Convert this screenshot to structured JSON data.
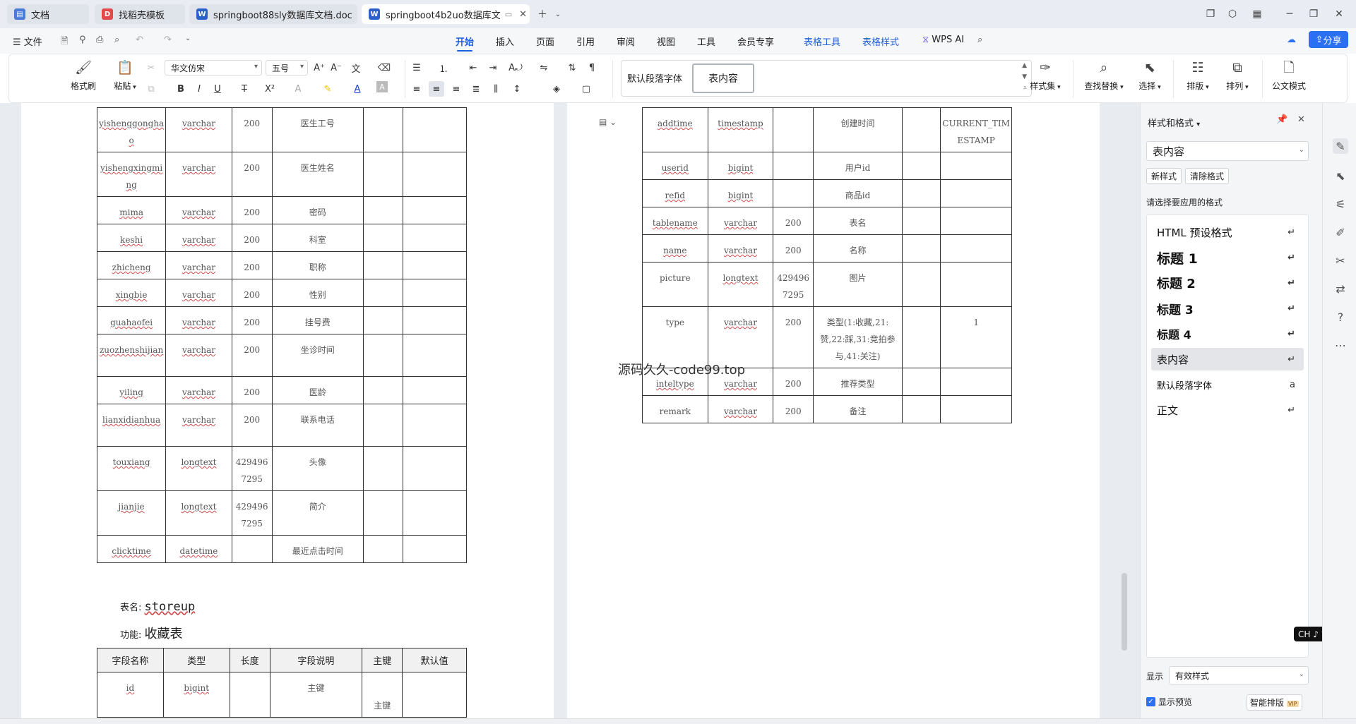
{
  "tabs": [
    {
      "label": "文档",
      "icon": "docs-icon",
      "color": "#4a7bd8"
    },
    {
      "label": "找稻壳模板",
      "icon": "docer-icon",
      "color": "#e24a4a"
    },
    {
      "label": "springboot88sly数据库文档.doc",
      "icon": "word-icon",
      "color": "#2b5fc9"
    },
    {
      "label": "springboot4b2uo数据库文",
      "icon": "word-icon",
      "color": "#2b5fc9"
    }
  ],
  "menu": {
    "file": "文件",
    "items": [
      "开始",
      "插入",
      "页面",
      "引用",
      "审阅",
      "视图",
      "工具",
      "会员专享",
      "表格工具",
      "表格样式"
    ],
    "wps_ai": "WPS AI",
    "share": "分享"
  },
  "ribbon": {
    "format_painter": "格式刷",
    "paste": "粘贴",
    "font_name": "华文仿宋",
    "font_size": "五号",
    "style_default": "默认段落字体",
    "style_current": "表内容",
    "style_set": "样式集",
    "find_replace": "查找替换",
    "select": "选择",
    "layout": "排版",
    "arrange": "排列",
    "official": "公文模式"
  },
  "left_table_rows": [
    {
      "name": "yishenggonghao",
      "type": "varchar",
      "len": "200",
      "desc": "医生工号",
      "pk": "",
      "def": ""
    },
    {
      "name": "yishengxingming",
      "type": "varchar",
      "len": "200",
      "desc": "医生姓名",
      "pk": "",
      "def": ""
    },
    {
      "name": "mima",
      "type": "varchar",
      "len": "200",
      "desc": "密码",
      "pk": "",
      "def": ""
    },
    {
      "name": "keshi",
      "type": "varchar",
      "len": "200",
      "desc": "科室",
      "pk": "",
      "def": ""
    },
    {
      "name": "zhicheng",
      "type": "varchar",
      "len": "200",
      "desc": "职称",
      "pk": "",
      "def": ""
    },
    {
      "name": "xingbie",
      "type": "varchar",
      "len": "200",
      "desc": "性别",
      "pk": "",
      "def": ""
    },
    {
      "name": "guahaofei",
      "type": "varchar",
      "len": "200",
      "desc": "挂号费",
      "pk": "",
      "def": ""
    },
    {
      "name": "zuozhenshijian",
      "type": "varchar",
      "len": "200",
      "desc": "坐诊时间",
      "pk": "",
      "def": ""
    },
    {
      "name": "yiling",
      "type": "varchar",
      "len": "200",
      "desc": "医龄",
      "pk": "",
      "def": ""
    },
    {
      "name": "lianxidianhua",
      "type": "varchar",
      "len": "200",
      "desc": "联系电话",
      "pk": "",
      "def": ""
    },
    {
      "name": "touxiang",
      "type": "longtext",
      "len": "4294967295",
      "desc": "头像",
      "pk": "",
      "def": ""
    },
    {
      "name": "jianjie",
      "type": "longtext",
      "len": "4294967295",
      "desc": "简介",
      "pk": "",
      "def": ""
    },
    {
      "name": "clicktime",
      "type": "datetime",
      "len": "",
      "desc": "最近点击时间",
      "pk": "",
      "def": ""
    }
  ],
  "storeup": {
    "table_label": "表名:",
    "table_name": "storeup",
    "func_label": "功能:",
    "func_name": "收藏表",
    "headers": [
      "字段名称",
      "类型",
      "长度",
      "字段说明",
      "主键",
      "默认值"
    ],
    "rows": [
      {
        "name": "id",
        "type": "bigint",
        "len": "",
        "desc": "主键",
        "pk": "主键",
        "def": ""
      }
    ]
  },
  "right_table_rows": [
    {
      "name": "addtime",
      "type": "timestamp",
      "len": "",
      "desc": "创建时间",
      "pk": "",
      "def": "CURRENT_TIMESTAMP"
    },
    {
      "name": "userid",
      "type": "bigint",
      "len": "",
      "desc": "用户id",
      "pk": "",
      "def": ""
    },
    {
      "name": "refid",
      "type": "bigint",
      "len": "",
      "desc": "商品id",
      "pk": "",
      "def": ""
    },
    {
      "name": "tablename",
      "type": "varchar",
      "len": "200",
      "desc": "表名",
      "pk": "",
      "def": ""
    },
    {
      "name": "name",
      "type": "varchar",
      "len": "200",
      "desc": "名称",
      "pk": "",
      "def": ""
    },
    {
      "name": "picture",
      "type": "longtext",
      "len": "4294967295",
      "desc": "图片",
      "pk": "",
      "def": ""
    },
    {
      "name": "type",
      "type": "varchar",
      "len": "200",
      "desc": "类型(1:收藏,21:赞,22:踩,31:竞拍参与,41:关注)",
      "pk": "",
      "def": "1"
    },
    {
      "name": "inteltype",
      "type": "varchar",
      "len": "200",
      "desc": "推荐类型",
      "pk": "",
      "def": ""
    },
    {
      "name": "remark",
      "type": "varchar",
      "len": "200",
      "desc": "备注",
      "pk": "",
      "def": ""
    }
  ],
  "watermark": "源码久久-code99.top",
  "panel": {
    "title": "样式和格式",
    "current_style": "表内容",
    "new_style": "新样式",
    "clear_format": "清除格式",
    "apply_hint": "请选择要应用的格式",
    "styles": [
      {
        "label": "HTML 预设格式",
        "size": 15,
        "bold": false
      },
      {
        "label": "标题  1",
        "size": 19,
        "bold": true
      },
      {
        "label": "标题  2",
        "size": 18,
        "bold": true
      },
      {
        "label": "标题  3",
        "size": 17,
        "bold": true
      },
      {
        "label": "标题  4",
        "size": 16,
        "bold": true
      },
      {
        "label": "表内容",
        "size": 15,
        "bold": false
      },
      {
        "label": "默认段落字体",
        "size": 13,
        "bold": false
      },
      {
        "label": "正文",
        "size": 15,
        "bold": false
      }
    ],
    "show_label": "显示",
    "show_value": "有效样式",
    "preview_label": "显示预览",
    "smart_layout": "智能排版",
    "vip": "VIP",
    "ime": "CH ♪ 简"
  }
}
